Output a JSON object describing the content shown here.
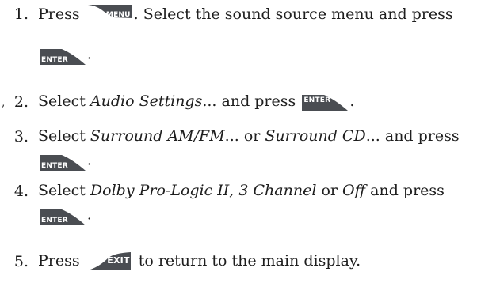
{
  "steps": [
    {
      "num": "1.",
      "part1": "Press",
      "key1": "MENU",
      "part2": ". Select the sound source menu and press",
      "key2": "ENTER",
      "end": "."
    },
    {
      "num": "2.",
      "part1": "Select",
      "italic1": "Audio Settings",
      "part2": "... and press",
      "key1": "ENTER",
      "end": "."
    },
    {
      "num": "3.",
      "part1": "Select",
      "italic1": "Surround AM/FM",
      "part2": "... or",
      "italic2": "Surround CD",
      "part3": "... and press",
      "key1": "ENTER",
      "end": "."
    },
    {
      "num": "4.",
      "part1": "Select",
      "italic1": "Dolby Pro-Logic II, 3 Channel",
      "part2": "or",
      "italic2": "Off",
      "part3": "and press",
      "key1": "ENTER",
      "end": "."
    },
    {
      "num": "5.",
      "part1": "Press",
      "key1": "EXIT",
      "part2": "to return to the main display."
    }
  ],
  "stray_mark": ",",
  "colors": {
    "text": "#1e1e1e",
    "key_fill": "#4a4d52",
    "key_label": "#ffffff"
  }
}
